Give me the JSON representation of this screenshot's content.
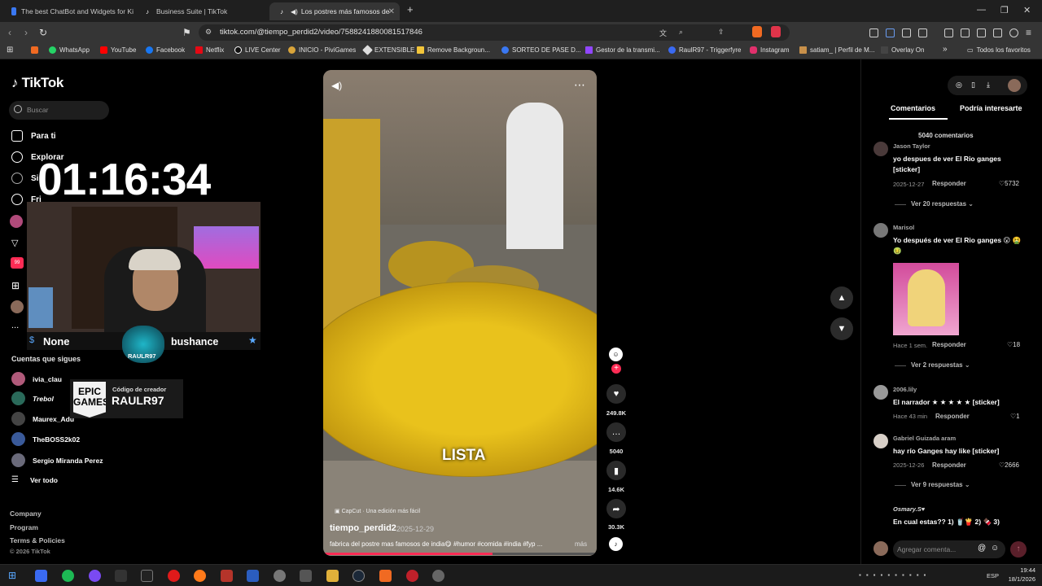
{
  "browser": {
    "tabs": [
      {
        "label": "The best ChatBot and Widgets for Ki",
        "active": false
      },
      {
        "label": "Business Suite | TikTok",
        "active": false
      },
      {
        "label": "Los postres más famosos de",
        "active": true
      }
    ],
    "url": "tiktok.com/@tiempo_perdid2/video/7588241880081517846",
    "bookmarks": [
      "WhatsApp",
      "YouTube",
      "Facebook",
      "Netflix",
      "LIVE Center",
      "INICIO - PiviGames",
      "EXTENSIBLE",
      "Remove Backgroun...",
      "SORTEO DE PASE D...",
      "Gestor de la transmi...",
      "RaulR97 - Triggerfyre",
      "Instagram",
      "satiam_ | Perfil de M...",
      "Overlay On"
    ],
    "bookmarks_more": "»",
    "all_bookmarks": "Todos los favoritos"
  },
  "tiktok": {
    "logo": "TikTok",
    "search_placeholder": "Buscar",
    "nav": {
      "for_you": "Para ti",
      "explore": "Explorar",
      "following_partial": "Si",
      "friends_partial": "Fri",
      "more": "..."
    },
    "following_title": "Cuentas que sigues",
    "following": [
      {
        "name": "ivia_clau",
        "color": "#b05a7a"
      },
      {
        "name": "Trebol",
        "color": "#2a6a5a"
      },
      {
        "name": "Maurex_Adu",
        "color": "#444444"
      },
      {
        "name": "TheBOSS2k02",
        "color": "#3a5a9a"
      },
      {
        "name": "Sergio Miranda Perez",
        "color": "#6a6a7a"
      }
    ],
    "see_all": "Ver todo",
    "footer": [
      "Company",
      "Program",
      "Terms & Policies",
      "© 2026 TikTok"
    ]
  },
  "overlay": {
    "timer": "01:16:34",
    "name_left": "None",
    "name_right": "bushance",
    "badge_text": "RAULR97",
    "epic_logo": "EPIC GAMES",
    "creator_code_label": "Código de creador",
    "creator_code": "RAULR97"
  },
  "video": {
    "caption_overlay": "LISTA",
    "capcut": "CapCut · Una edición más fácil",
    "username": "tiempo_perdid2",
    "date": "2025-12-29",
    "description": "fabrica del postre mas famosos de india😋 #humor #comida #india #fyp ...",
    "more": "más",
    "progress_fraction": 0.62
  },
  "actions": {
    "likes": "249.8K",
    "comments": "5040",
    "saves": "14.6K",
    "shares": "30.3K"
  },
  "comments_panel": {
    "tab_comments": "Comentarios",
    "tab_interesting": "Podría interesarte",
    "count_label": "5040 comentarios",
    "comments": [
      {
        "user": "Jason Taylor",
        "text": "yo despues de ver El Rio ganges [sticker]",
        "date": "2025-12-27",
        "reply": "Responder",
        "likes": "5732",
        "more": "Ver 20 respuestas"
      },
      {
        "user": "Marisol",
        "text": "Yo después de ver El Rio ganges 😮 🤮 🤢",
        "date": "Hace 1 sem.",
        "reply": "Responder",
        "likes": "18",
        "more": "Ver 2 respuestas"
      },
      {
        "user": "2006.lily",
        "text": "El narrador ★ ★ ★ ★ ★ [sticker]",
        "date": "Hace 43 min",
        "reply": "Responder",
        "likes": "1",
        "more": ""
      },
      {
        "user": "Gabriel Guizada aram",
        "text": "hay río Ganges hay like [sticker]",
        "date": "2025-12-26",
        "reply": "Responder",
        "likes": "2666",
        "more": "Ver 9 respuestas"
      },
      {
        "user": "Osmary.S♥",
        "text": "En cual estas?? 1) 🥤🍟 2) 🍫 3)",
        "date": "",
        "reply": "",
        "likes": "",
        "more": ""
      }
    ],
    "input_placeholder": "Agregar comenta..."
  },
  "taskbar": {
    "time": "19:44",
    "date": "18/1/2026",
    "lang": "ESP"
  },
  "colors": {
    "accent": "#fe2c55",
    "video_gold": "#e9c21c"
  }
}
